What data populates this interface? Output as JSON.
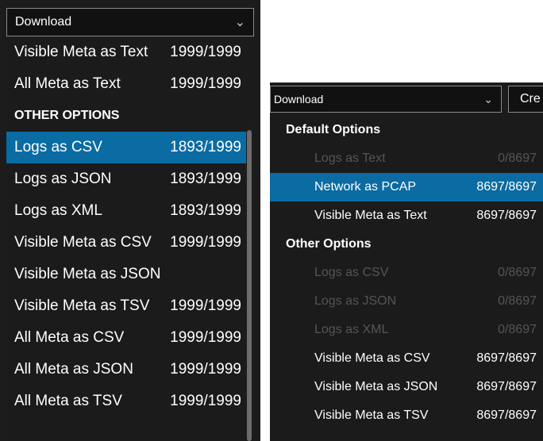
{
  "left": {
    "dropdown_label": "Download",
    "items": [
      {
        "type": "option",
        "name": "Visible Meta as Text",
        "count": "1999/1999",
        "state": "normal"
      },
      {
        "type": "option",
        "name": "All Meta as Text",
        "count": "1999/1999",
        "state": "normal"
      },
      {
        "type": "header",
        "name": "OTHER OPTIONS",
        "count": "",
        "state": "header"
      },
      {
        "type": "option",
        "name": "Logs as CSV",
        "count": "1893/1999",
        "state": "selected"
      },
      {
        "type": "option",
        "name": "Logs as JSON",
        "count": "1893/1999",
        "state": "normal"
      },
      {
        "type": "option",
        "name": "Logs as XML",
        "count": "1893/1999",
        "state": "normal"
      },
      {
        "type": "option",
        "name": "Visible Meta as CSV",
        "count": "1999/1999",
        "state": "normal"
      },
      {
        "type": "option",
        "name": "Visible Meta as JSON",
        "count": "",
        "state": "normal"
      },
      {
        "type": "option",
        "name": "Visible Meta as TSV",
        "count": "1999/1999",
        "state": "normal"
      },
      {
        "type": "option",
        "name": "All Meta as CSV",
        "count": "1999/1999",
        "state": "normal"
      },
      {
        "type": "option",
        "name": "All Meta as JSON",
        "count": "1999/1999",
        "state": "normal"
      },
      {
        "type": "option",
        "name": "All Meta as TSV",
        "count": "1999/1999",
        "state": "normal"
      }
    ]
  },
  "right": {
    "dropdown_label": "Download",
    "create_button_label": "Cre",
    "items": [
      {
        "type": "header",
        "name": "Default Options",
        "count": "",
        "state": "header"
      },
      {
        "type": "option",
        "name": "Logs as Text",
        "count": "0/8697",
        "state": "disabled"
      },
      {
        "type": "option",
        "name": "Network as PCAP",
        "count": "8697/8697",
        "state": "selected"
      },
      {
        "type": "option",
        "name": "Visible Meta as Text",
        "count": "8697/8697",
        "state": "normal"
      },
      {
        "type": "header",
        "name": "Other Options",
        "count": "",
        "state": "header"
      },
      {
        "type": "option",
        "name": "Logs as CSV",
        "count": "0/8697",
        "state": "disabled"
      },
      {
        "type": "option",
        "name": "Logs as JSON",
        "count": "0/8697",
        "state": "disabled"
      },
      {
        "type": "option",
        "name": "Logs as XML",
        "count": "0/8697",
        "state": "disabled"
      },
      {
        "type": "option",
        "name": "Visible Meta as CSV",
        "count": "8697/8697",
        "state": "normal"
      },
      {
        "type": "option",
        "name": "Visible Meta as JSON",
        "count": "8697/8697",
        "state": "normal"
      },
      {
        "type": "option",
        "name": "Visible Meta as TSV",
        "count": "8697/8697",
        "state": "normal"
      }
    ]
  },
  "caret_glyph": "⌄",
  "colors": {
    "selected_bg": "#0b6ba3",
    "menu_bg": "#1b1b1b",
    "disabled_text": "#555555"
  }
}
